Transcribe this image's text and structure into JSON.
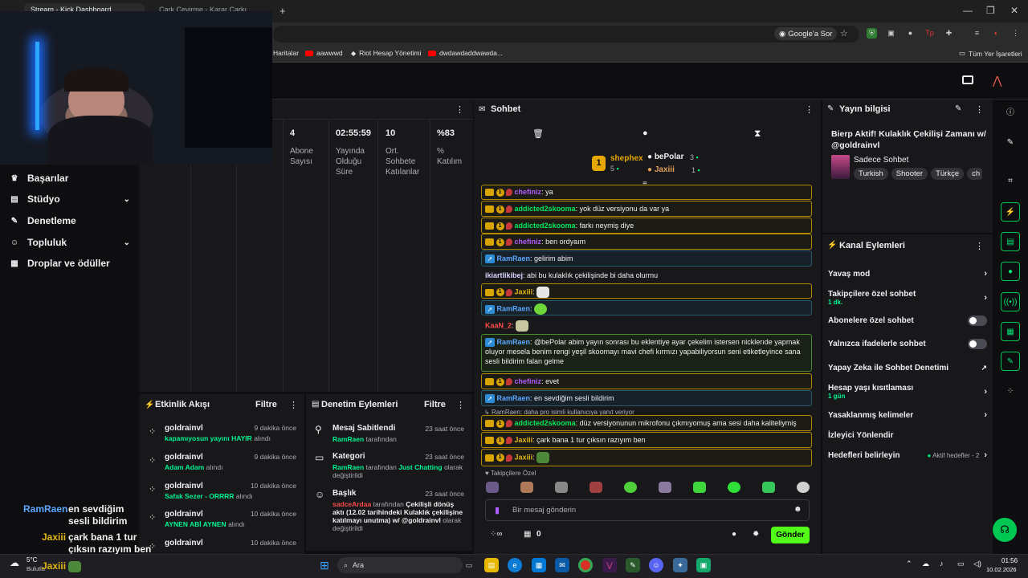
{
  "browser": {
    "tab1_label": "Stream - Kick Dashboard",
    "tab2_label": "Çark Çevirme - Karar Çarkı",
    "new_tab": "+",
    "google_ask": "Google'a Sor",
    "bookmarks": [
      "Haritalar",
      "aawwwd",
      "Riot Hesap Yönetimi",
      "dwdawdaddwawda..."
    ],
    "all_bookmarks": "Tüm Yer İşaretleri"
  },
  "sidebar": {
    "items": [
      {
        "label": "Başarılar",
        "icon": "trophy-icon"
      },
      {
        "label": "Stüdyo",
        "icon": "studio-icon",
        "expandable": true
      },
      {
        "label": "Denetleme",
        "icon": "wrench-icon"
      },
      {
        "label": "Topluluk",
        "icon": "community-icon",
        "expandable": true
      },
      {
        "label": "Droplar ve ödüller",
        "icon": "gift-icon"
      }
    ]
  },
  "stats": {
    "columns": [
      {
        "value": "4",
        "label": "Abone Sayısı"
      },
      {
        "value": "02:55:59",
        "label": "Yayında Olduğu Süre"
      },
      {
        "value": "10",
        "label": "Ort. Sohbete Katılanlar"
      },
      {
        "value": "%83",
        "label": "% Katılım"
      }
    ]
  },
  "activity": {
    "title": "Etkinlik Akışı",
    "filter": "Filtre",
    "rows": [
      {
        "user": "goldrainvl",
        "time": "9 dakika önce",
        "reward": "kapamıyosun yayını HAYIR",
        "suffix": "alındı"
      },
      {
        "user": "goldrainvl",
        "time": "9 dakika önce",
        "reward": "Adam Adam",
        "suffix": "alındı"
      },
      {
        "user": "goldrainvl",
        "time": "10 dakika önce",
        "reward": "Safak Sezer - ORRRR",
        "suffix": "alındı"
      },
      {
        "user": "goldrainvl",
        "time": "10 dakika önce",
        "reward": "AYNEN ABİ AYNEN",
        "suffix": "alındı"
      },
      {
        "user": "goldrainvl",
        "time": "10 dakika önce",
        "reward": "",
        "suffix": ""
      }
    ]
  },
  "mod_actions": {
    "title": "Denetim Eylemleri",
    "filter": "Filtre",
    "rows": [
      {
        "title": "Mesaj Sabitlendi",
        "time": "23 saat önce",
        "actor": "RamRaen",
        "text": "tarafından"
      },
      {
        "title": "Kategori",
        "time": "23 saat önce",
        "actor": "RamRaen",
        "text": "tarafından",
        "highlight": "Just Chatting",
        "rest": "olarak değiştirildi"
      },
      {
        "title": "Başlık",
        "time": "23 saat önce",
        "actor": "sadceArdaa",
        "text": "tarafından",
        "highlight": "Çekilişli dönüş aktı (12.02 tarihindeki Kulaklık çekilişine katılmayı unutma) w/ @goldrainvl",
        "rest": "olarak değiştirildi"
      }
    ]
  },
  "chat": {
    "title": "Sohbet",
    "leaderboard": {
      "first": {
        "rank": "1",
        "name": "shephex",
        "count": "5"
      },
      "second": {
        "name": "bePolar",
        "count": "3"
      },
      "third": {
        "name": "Jaxiii",
        "count": "1"
      }
    },
    "messages": [
      {
        "user": "chefiniz",
        "color": "purple",
        "text": ": ya",
        "style": "gold"
      },
      {
        "user": "addicted2skooma",
        "color": "green",
        "text": ": yok düz versiyonu da var ya",
        "style": "gold"
      },
      {
        "user": "addicted2skooma",
        "color": "green",
        "text": ": farkı neymiş diye",
        "style": "gold"
      },
      {
        "user": "chefiniz",
        "color": "purple",
        "text": ": ben ordyaım",
        "style": "gold"
      },
      {
        "user": "RamRaen",
        "color": "blue",
        "text": ": gelirim abim",
        "style": "blue"
      },
      {
        "user": "ikiartlikibej",
        "color": "white",
        "text": ": abi bu kulaklık çekilişinde bi daha olurmu",
        "style": "plain"
      },
      {
        "user": "Jaxiii",
        "color": "yellow",
        "text": ":",
        "style": "gold"
      },
      {
        "user": "RamRaen",
        "color": "blue",
        "text": ":",
        "style": "blue"
      },
      {
        "user": "KaaN_2",
        "color": "red",
        "text": ":",
        "style": "plain"
      },
      {
        "user": "RamRaen",
        "color": "blue",
        "text": ": @bePolar abim yayın sonrası bu eklentiye ayar çekelim istersen nicklerıde yapmak oluyor mesela benim rengi yeşil skoomayı mavi chefi kırmızı yapabiliyorsun seni etiketleyince sana sesli bildirim falan gelme",
        "style": "green"
      },
      {
        "user": "chefiniz",
        "color": "purple",
        "text": ": evet",
        "style": "gold"
      },
      {
        "user": "RamRaen",
        "color": "blue",
        "text": ": en sevdiğim sesli bildirim",
        "style": "blue"
      },
      {
        "user": "addicted2skooma",
        "color": "green",
        "text": ": düz versiyonunun mikrofonu çıkmıyomuş ama sesi daha kaliteliymiş",
        "style": "gold",
        "reply": "RamRaen: daha pro isimli kullanıcıya yanıt veriyor"
      },
      {
        "user": "Jaxiii",
        "color": "yellow",
        "text": ": çark bana 1 tur çıksın razıyım ben",
        "style": "gold"
      },
      {
        "user": "Jaxiii",
        "color": "yellow",
        "text": ":",
        "style": "gold"
      }
    ],
    "emote_section": "Takipçilere Özel",
    "input_placeholder": "Bir mesaj gönderin",
    "points": "0",
    "send": "Gönder"
  },
  "stream_info": {
    "title": "Yayın bilgisi",
    "stream_title": "Bierp Aktif! Kulaklık Çekilişi Zamanı w/ @goldrainvl",
    "category": "Sadece Sohbet",
    "tags": [
      "Turkish",
      "Shooter",
      "Türkçe",
      "ch"
    ]
  },
  "channel_actions": {
    "title": "Kanal Eylemleri",
    "rows": [
      {
        "label": "Yavaş mod",
        "type": "chevron"
      },
      {
        "label": "Takipçilere özel sohbet",
        "sub": "1 dk.",
        "type": "chevron"
      },
      {
        "label": "Abonelere özel sohbet",
        "type": "toggle"
      },
      {
        "label": "Yalnızca ifadelerle sohbet",
        "type": "toggle"
      },
      {
        "label": "Yapay Zeka ile Sohbet Denetimi",
        "type": "external"
      },
      {
        "label": "Hesap yaşı kısıtlaması",
        "sub": "1 gün",
        "type": "chevron"
      },
      {
        "label": "Yasaklanmış kelimeler",
        "type": "chevron"
      },
      {
        "label": "İzleyici Yönlendir",
        "type": "none"
      },
      {
        "label": "Hedefleri belirleyin",
        "sub": "Aktif hedefler - 2",
        "type": "chevron"
      }
    ]
  },
  "overlay": {
    "lines": [
      {
        "name": "RamRaen",
        "text": "en sevdiğim sesli bildirim"
      },
      {
        "name": "Jaxiii",
        "text": "çark bana 1 tur çıksın razıyım ben"
      },
      {
        "name": "Jaxiii",
        "text": ""
      }
    ]
  },
  "taskbar": {
    "weather_temp": "5°C",
    "weather_desc": "Bulutlu",
    "search": "Ara",
    "time": "01:56",
    "date": "10.02.2026"
  },
  "colors": {
    "accent": "#53fc18",
    "kick_green": "#00f593",
    "panel": "#18181b",
    "bg": "#0e0e10"
  }
}
